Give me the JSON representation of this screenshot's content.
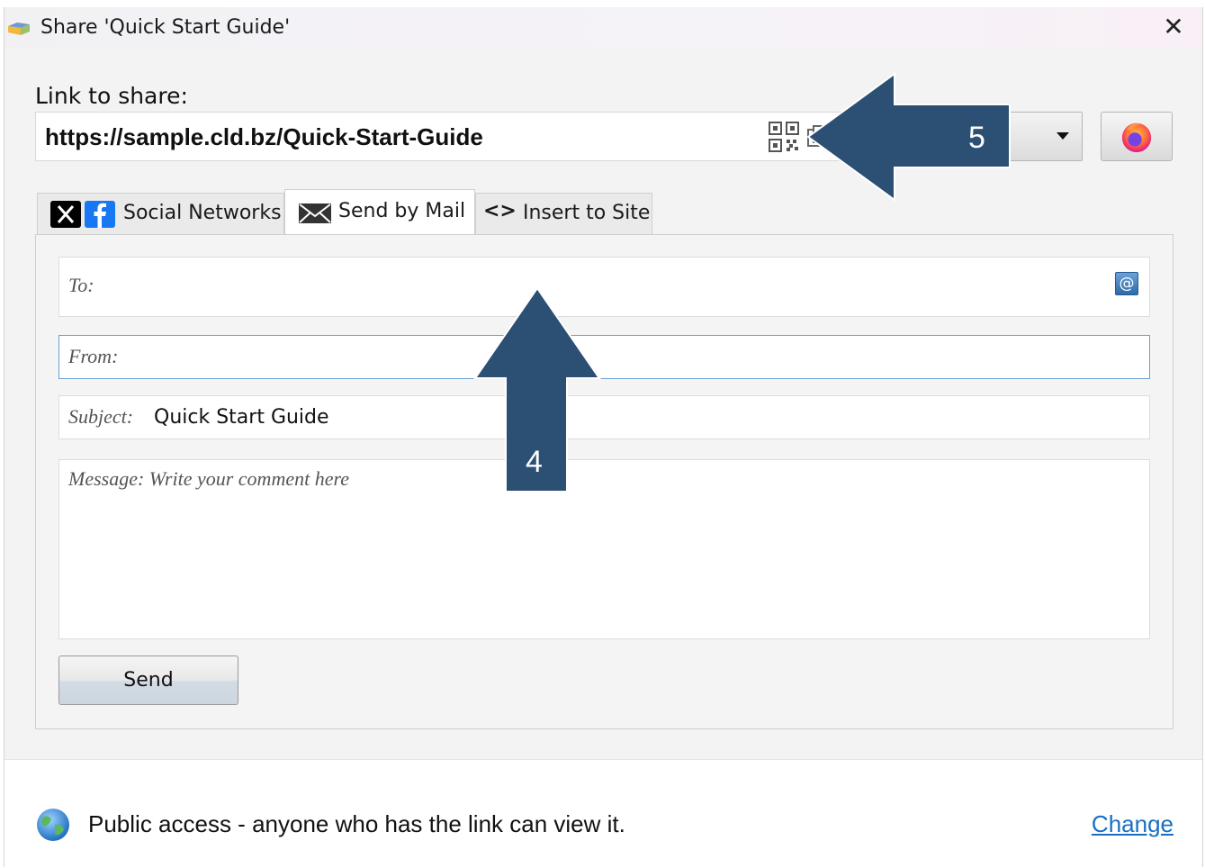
{
  "window": {
    "title": "Share 'Quick Start Guide'"
  },
  "link": {
    "label": "Link to share:",
    "url": "https://sample.cld.bz/Quick-Start-Guide"
  },
  "tabs": [
    {
      "label": "Social Networks",
      "active": false
    },
    {
      "label": "Send by Mail",
      "active": true
    },
    {
      "label": "Insert to Site",
      "active": false
    }
  ],
  "mail": {
    "to_placeholder": "To:",
    "from_placeholder": "From:",
    "subject_label": "Subject:",
    "subject_value": "Quick Start Guide",
    "message_placeholder": "Message: Write your comment here",
    "send_label": "Send"
  },
  "footer": {
    "access_text": "Public access - anyone who has the link can view it.",
    "change_label": "Change"
  },
  "annotations": {
    "arrow_up_number": "4",
    "arrow_left_number": "5"
  },
  "colors": {
    "annotation_arrow": "#2c4f74",
    "link": "#1a6fc4",
    "focus_border": "#6b9fd3"
  },
  "icons": [
    "app-icon",
    "close-icon",
    "qr-code-icon",
    "copy-icon",
    "chevron-down-icon",
    "firefox-icon",
    "x-logo-icon",
    "facebook-icon",
    "mail-icon",
    "code-icon",
    "address-book-icon",
    "globe-icon"
  ]
}
